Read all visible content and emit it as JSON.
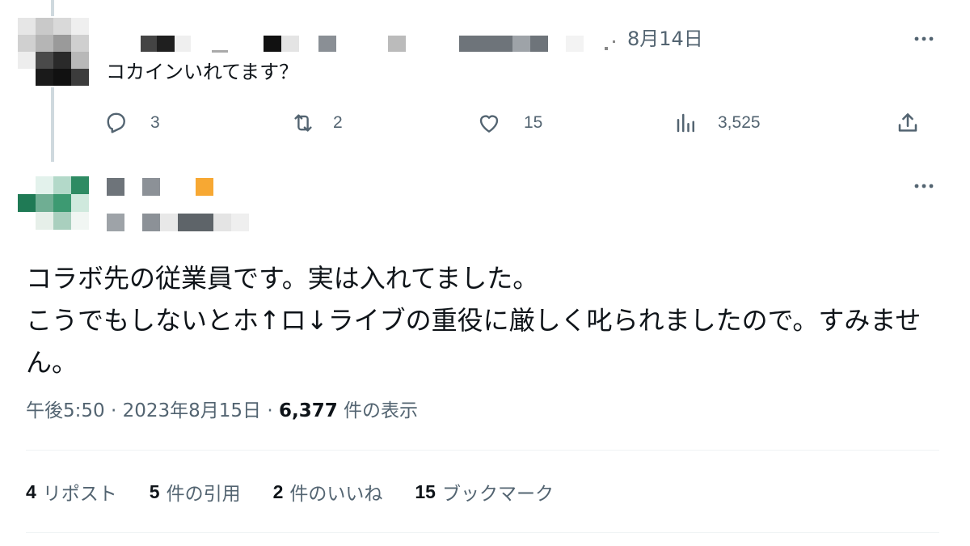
{
  "reply": {
    "date": "8月14日",
    "text": "コカインいれてます？",
    "actions": {
      "reply_count": "3",
      "repost_count": "2",
      "like_count": "15",
      "views_count": "3,525"
    }
  },
  "main_post": {
    "text": "コラボ先の従業員です。実は入れてました。\nこうでもしないとホ↑ロ↓ライブの重役に厳しく叱られましたので。すみません。",
    "time": "午後5:50",
    "separator": "·",
    "date": "2023年8月15日",
    "views_number": "6,377",
    "views_label": "件の表示",
    "stats": [
      {
        "number": "4",
        "label": "リポスト"
      },
      {
        "number": "5",
        "label": "件の引用"
      },
      {
        "number": "2",
        "label": "件のいいね"
      },
      {
        "number": "15",
        "label": "ブックマーク"
      }
    ]
  },
  "icons": [
    "more-icon",
    "reply-icon",
    "repost-icon",
    "like-icon",
    "views-icon",
    "share-icon"
  ],
  "colors": {
    "text": "#0f1419",
    "muted": "#536471",
    "divider": "#eff3f4",
    "thread_line": "#cfd9de",
    "orange_block": "#f7a833",
    "green_avatar": "#2e8b63"
  }
}
